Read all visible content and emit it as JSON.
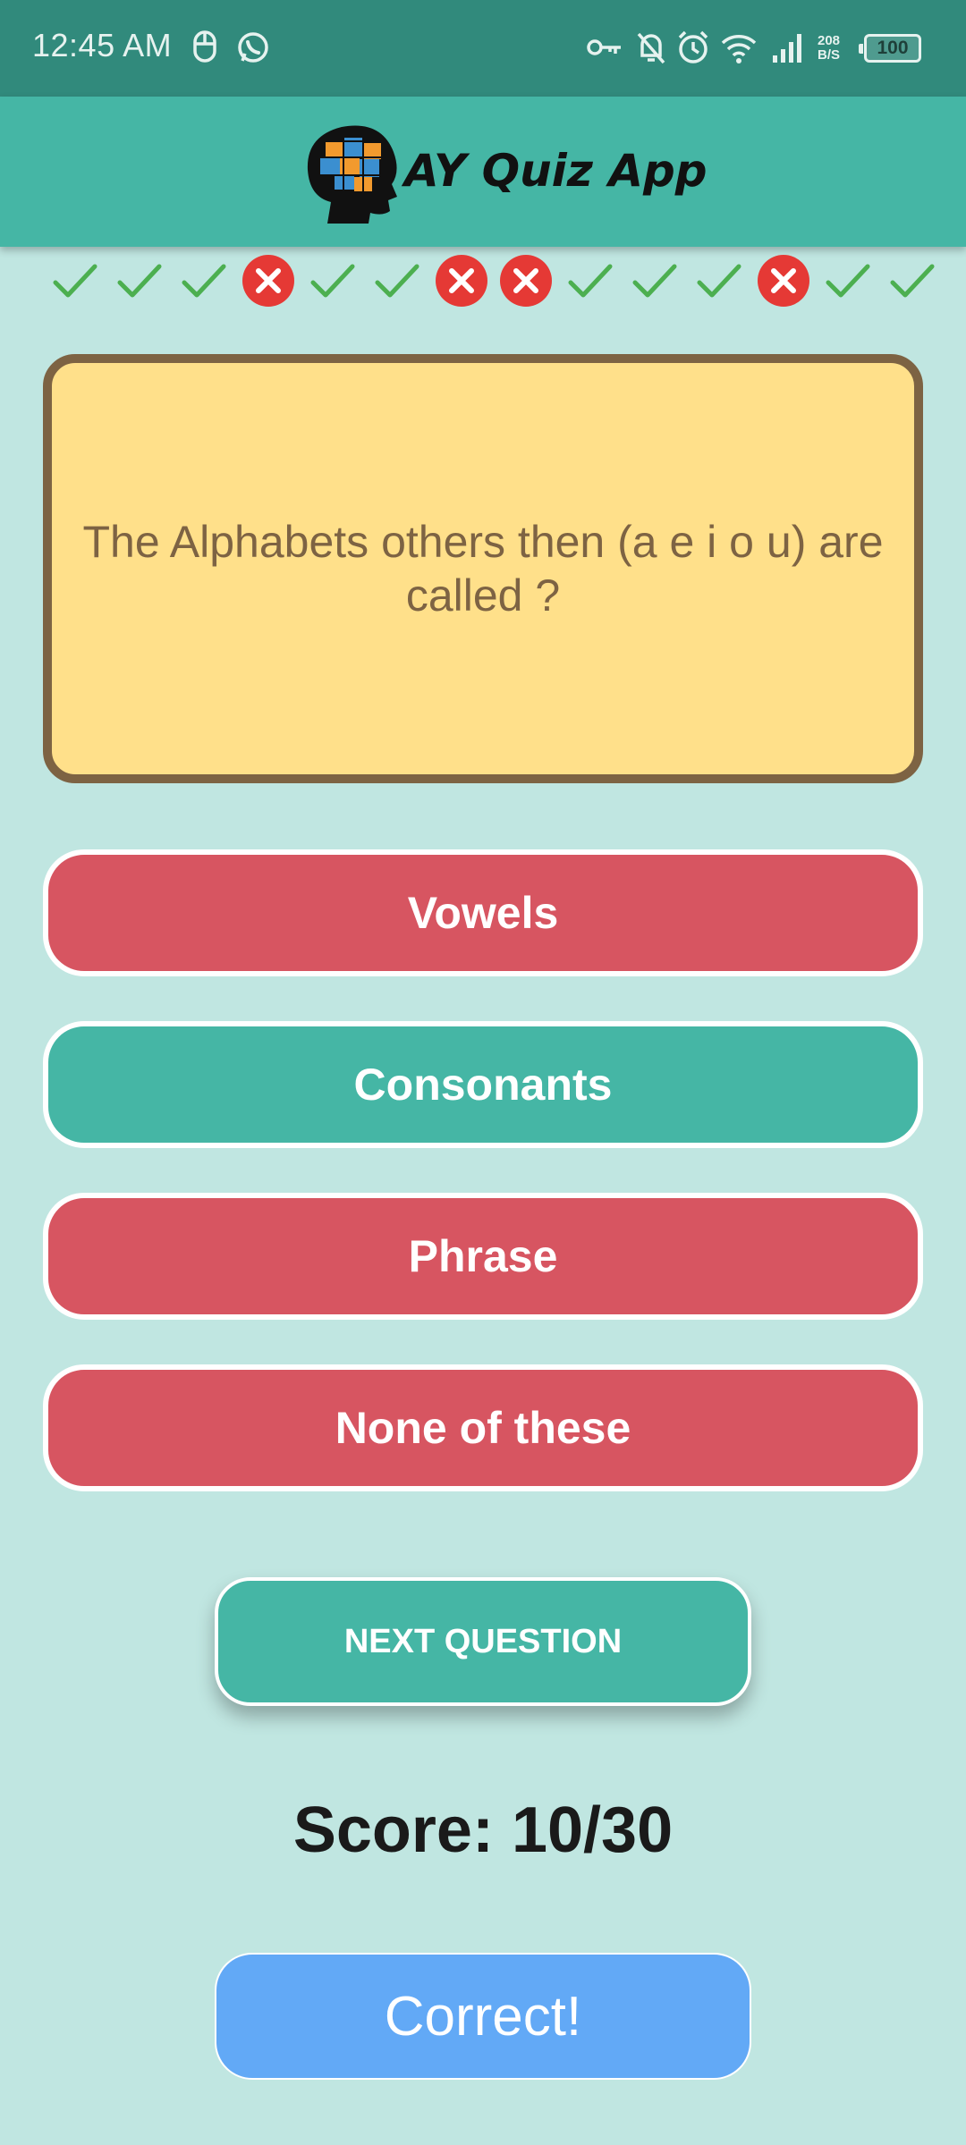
{
  "status_bar": {
    "time": "12:45 AM",
    "left_icons": [
      "mouse-icon",
      "whatsapp-icon"
    ],
    "right_icons": [
      "vpn-key-icon",
      "mute-bell-icon",
      "alarm-icon",
      "wifi-icon",
      "signal-icon"
    ],
    "net_speed_value": "208",
    "net_speed_unit": "B/S",
    "battery": "100"
  },
  "app_bar": {
    "title": "AY Quiz App",
    "logo_icon": "head-puzzle-logo"
  },
  "progress": [
    "correct",
    "correct",
    "correct",
    "wrong",
    "correct",
    "correct",
    "wrong",
    "wrong",
    "correct",
    "correct",
    "correct",
    "wrong",
    "correct",
    "correct"
  ],
  "question": {
    "text": "The Alphabets others then (a e i o u) are called ?"
  },
  "options": [
    {
      "label": "Vowels",
      "state": "wrong"
    },
    {
      "label": "Consonants",
      "state": "right"
    },
    {
      "label": "Phrase",
      "state": "wrong"
    },
    {
      "label": "None of these",
      "state": "wrong"
    }
  ],
  "next_button": "NEXT QUESTION",
  "score_text": "Score: 10/30",
  "result_text": "Correct!",
  "colors": {
    "status_bar": "#318a7c",
    "app_bar": "#45b6a5",
    "background": "#c0e6e1",
    "card_fill": "#ffe08a",
    "card_border": "#7d6343",
    "wrong": "#d75561",
    "right": "#45b6a5",
    "result": "#62a9f6",
    "check_mark": "#4caf50",
    "x_mark": "#e53935"
  }
}
